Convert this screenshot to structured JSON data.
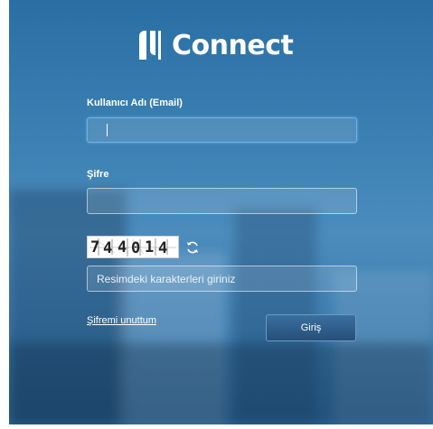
{
  "brand": {
    "name": "Connect",
    "logo_icon": "n-logo-icon"
  },
  "form": {
    "username_label": "Kullanıcı Adı (Email)",
    "username_value": "",
    "password_label": "Şifre",
    "password_value": "",
    "captcha_text": "744014",
    "captcha_placeholder": "Resimdeki karakterleri giriniz",
    "refresh_icon": "refresh-icon",
    "forgot_password": "Şifremi unuttum",
    "submit_label": "Giriş"
  }
}
